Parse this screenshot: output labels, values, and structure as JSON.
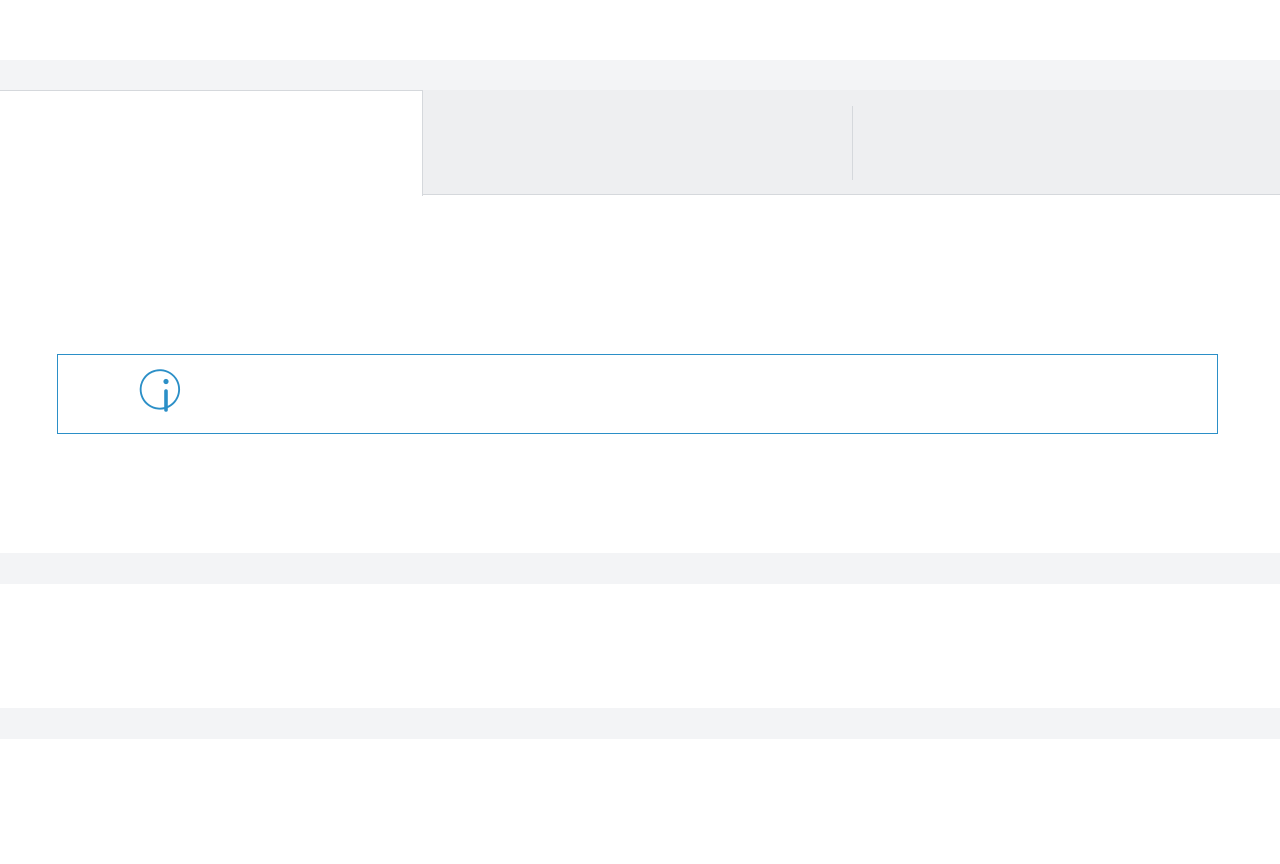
{
  "tabs": [
    {
      "label": "",
      "active": true
    },
    {
      "label": "",
      "active": false
    },
    {
      "label": "",
      "active": false
    }
  ],
  "info_box": {
    "icon": "info-icon",
    "message": "",
    "accent_color": "#2b8fc7"
  },
  "colors": {
    "band": "#f3f4f6",
    "tab_inactive": "#eeeff1",
    "border": "#d5d8dc"
  }
}
